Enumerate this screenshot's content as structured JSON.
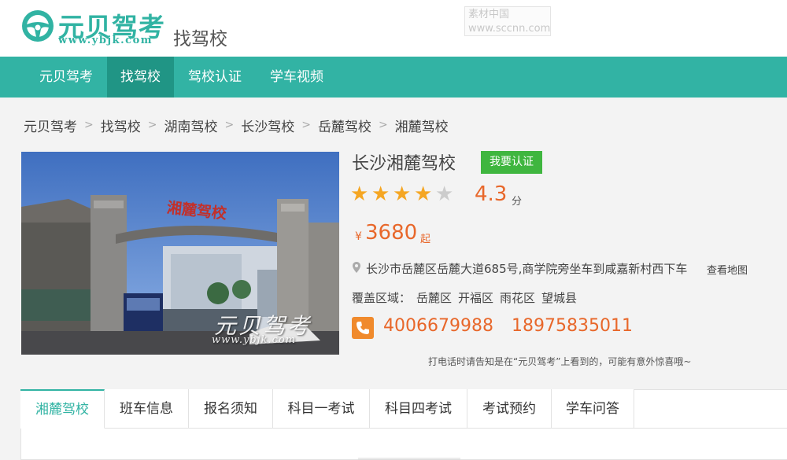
{
  "header": {
    "logo_name": "元贝驾考",
    "logo_url": "www.ybjk.com",
    "section_title": "找驾校",
    "watermark_line1": "素材中国",
    "watermark_line2": "www.sccnn.com"
  },
  "nav": {
    "items": [
      {
        "label": "元贝驾考"
      },
      {
        "label": "找驾校"
      },
      {
        "label": "驾校认证"
      },
      {
        "label": "学车视频"
      }
    ],
    "active_index": 1
  },
  "breadcrumb": [
    "元贝驾考",
    "找驾校",
    "湖南驾校",
    "长沙驾校",
    "岳麓驾校",
    "湘麓驾校"
  ],
  "photo": {
    "gate_sign": "湘麓驾校",
    "watermark_cn": "元贝驾考",
    "watermark_url": "www.ybjk.com"
  },
  "school": {
    "name": "长沙湘麓驾校",
    "certify_label": "我要认证",
    "rating_stars": 4,
    "rating_max": 5,
    "rating": "4.3",
    "rating_unit": "分",
    "price_currency": "¥",
    "price": "3680",
    "price_suffix": "起",
    "address": "长沙市岳麓区岳麓大道685号,商学院旁坐车到咸嘉新村西下车",
    "map_link": "查看地图",
    "coverage_label": "覆盖区域：",
    "coverage": [
      "岳麓区",
      "开福区",
      "雨花区",
      "望城县"
    ],
    "phone1": "4006679988",
    "phone2": "18975835011",
    "call_tip": "打电话时请告知是在“元贝驾考”上看到的，可能有意外惊喜哦~"
  },
  "tabs": {
    "items": [
      {
        "label": "湘麓驾校"
      },
      {
        "label": "班车信息"
      },
      {
        "label": "报名须知"
      },
      {
        "label": "科目一考试"
      },
      {
        "label": "科目四考试"
      },
      {
        "label": "考试预约"
      },
      {
        "label": "学车问答"
      }
    ],
    "active_index": 0
  },
  "colors": {
    "brand": "#32b3a4",
    "brand_dark": "#209585",
    "accent": "#e8672a",
    "star": "#f5a623",
    "certify": "#3fb63f",
    "phone_icon": "#f08a2c"
  },
  "icons": [
    "steering-wheel-icon",
    "chevron-right-icon",
    "star-icon",
    "map-pin-icon",
    "phone-icon"
  ]
}
